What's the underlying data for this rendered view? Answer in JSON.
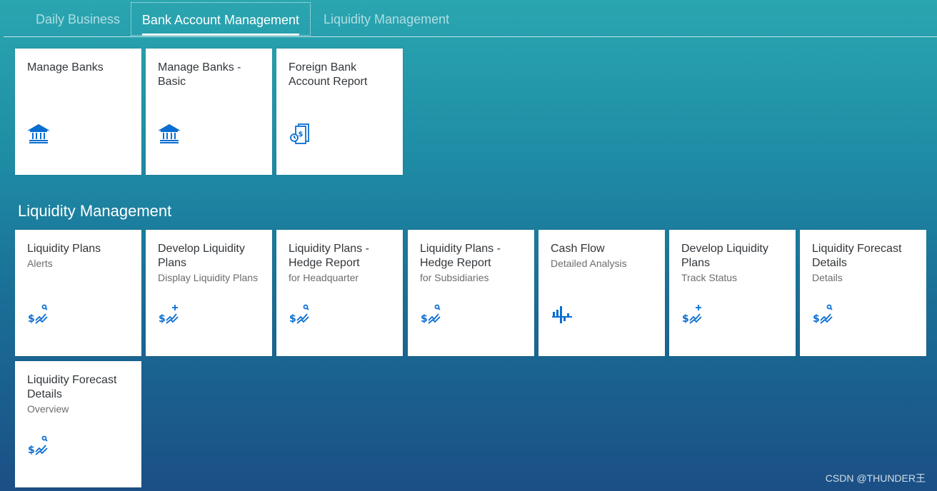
{
  "tabs": [
    {
      "label": "Daily Business"
    },
    {
      "label": "Bank Account Management"
    },
    {
      "label": "Liquidity Management"
    }
  ],
  "bank_group": {
    "tiles": [
      {
        "title": "Manage Banks",
        "subtitle": "",
        "icon": "bank-icon"
      },
      {
        "title": "Manage Banks - Basic",
        "subtitle": "",
        "icon": "bank-icon"
      },
      {
        "title": "Foreign Bank Account Report",
        "subtitle": "",
        "icon": "report-document-icon"
      }
    ]
  },
  "liquidity_group": {
    "title": "Liquidity Management",
    "tiles": [
      {
        "title": "Liquidity Plans",
        "subtitle": "Alerts",
        "icon": "dollar-trend-search-icon"
      },
      {
        "title": "Develop Liquidity Plans",
        "subtitle": "Display Liquidity Plans",
        "icon": "dollar-trend-add-icon"
      },
      {
        "title": "Liquidity Plans - Hedge Report",
        "subtitle": "for Headquarter",
        "icon": "dollar-trend-search-icon"
      },
      {
        "title": "Liquidity Plans - Hedge Report",
        "subtitle": "for Subsidiaries",
        "icon": "dollar-trend-search-icon"
      },
      {
        "title": "Cash Flow",
        "subtitle": "Detailed Analysis",
        "icon": "cash-flow-chart-icon"
      },
      {
        "title": "Develop Liquidity Plans",
        "subtitle": "Track Status",
        "icon": "dollar-trend-add-icon"
      },
      {
        "title": "Liquidity Forecast Details",
        "subtitle": "Details",
        "icon": "dollar-trend-search-icon"
      },
      {
        "title": "Liquidity Forecast Details",
        "subtitle": "Overview",
        "icon": "dollar-trend-search-icon"
      }
    ]
  },
  "colors": {
    "icon": "#0a6ed1",
    "tile_title": "#32363a",
    "tile_subtitle": "#6a6d70"
  },
  "watermark": "CSDN @THUNDER王"
}
